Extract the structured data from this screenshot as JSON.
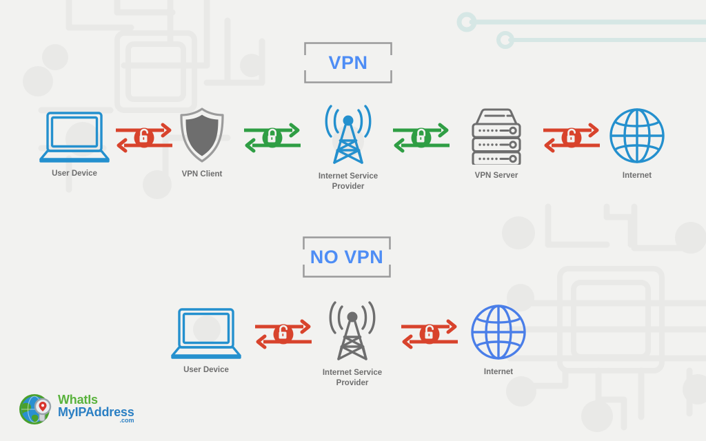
{
  "meta": {
    "title": "VPN vs NO VPN connection diagram",
    "bg_color": "#f2f2f0",
    "decor_color": "#e9e9e7",
    "decor_teal": "#d6e7e5"
  },
  "colors": {
    "accent_blue": "#4e8df5",
    "icon_blue": "#2490ce",
    "icon_blue_alt": "#4a7ee8",
    "icon_gray": "#6e6e6e",
    "secure_green": "#2f9e44",
    "insecure_red": "#d8432c",
    "label_gray": "#6e6e6e",
    "badge_border": "#9a9a9a"
  },
  "sections": [
    {
      "id": "vpn",
      "badge_label": "VPN",
      "nodes": [
        {
          "id": "user-device",
          "label": "User Device",
          "icon": "laptop-icon",
          "color": "#2490ce"
        },
        {
          "id": "vpn-client",
          "label": "VPN Client",
          "icon": "shield-icon",
          "color": "#6e6e6e"
        },
        {
          "id": "isp",
          "label": "Internet Service\nProvider",
          "icon": "radio-tower-icon",
          "color": "#2490ce"
        },
        {
          "id": "vpn-server",
          "label": "VPN Server",
          "icon": "server-rack-icon",
          "color": "#6e6e6e"
        },
        {
          "id": "internet",
          "label": "Internet",
          "icon": "globe-icon",
          "color": "#2490ce"
        }
      ],
      "links": [
        {
          "id": "link-user-to-client",
          "state": "insecure",
          "lock": "unlocked-padlock-icon",
          "color": "#d8432c"
        },
        {
          "id": "link-client-to-isp",
          "state": "secure",
          "lock": "locked-padlock-icon",
          "color": "#2f9e44"
        },
        {
          "id": "link-isp-to-server",
          "state": "secure",
          "lock": "locked-padlock-icon",
          "color": "#2f9e44"
        },
        {
          "id": "link-server-to-internet",
          "state": "insecure",
          "lock": "unlocked-padlock-icon",
          "color": "#d8432c"
        }
      ]
    },
    {
      "id": "no-vpn",
      "badge_label": "NO VPN",
      "nodes": [
        {
          "id": "user-device-2",
          "label": "User Device",
          "icon": "laptop-icon",
          "color": "#2490ce"
        },
        {
          "id": "isp-2",
          "label": "Internet Service\nProvider",
          "icon": "radio-tower-icon",
          "color": "#6e6e6e"
        },
        {
          "id": "internet-2",
          "label": "Internet",
          "icon": "globe-icon",
          "color": "#4a7ee8"
        }
      ],
      "links": [
        {
          "id": "link-user-to-isp-2",
          "state": "insecure",
          "lock": "unlocked-padlock-icon",
          "color": "#d8432c"
        },
        {
          "id": "link-isp-to-internet-2",
          "state": "insecure",
          "lock": "unlocked-padlock-icon",
          "color": "#d8432c"
        }
      ]
    }
  ],
  "logo": {
    "line1": "WhatIs",
    "line2": "MyIPAddress",
    "line3": ".com",
    "mark": "globe-magnifier-icon",
    "green": "#59b23c",
    "blue": "#2a7fc3"
  }
}
